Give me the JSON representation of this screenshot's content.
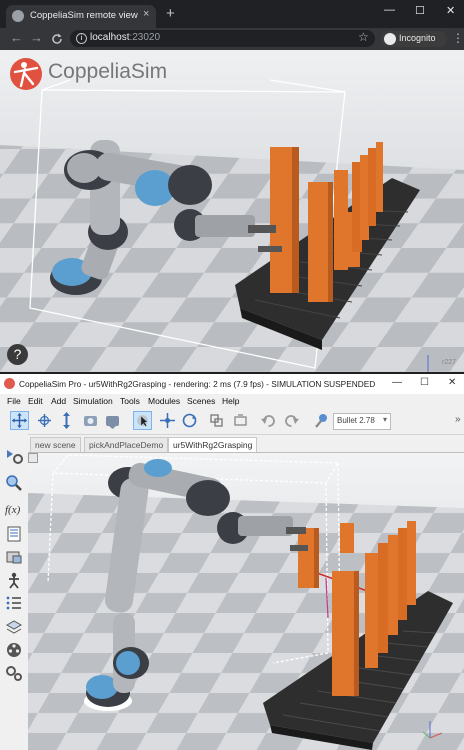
{
  "browser": {
    "tab_title": "CoppeliaSim remote view",
    "tab_close": "×",
    "new_tab": "+",
    "window_controls": [
      "—",
      "☐",
      "✕"
    ],
    "nav": {
      "back": "←",
      "forward": "→",
      "reload": "C"
    },
    "url_host": "localhost",
    "url_port": ":23020",
    "star": "☆",
    "incognito_label": "Incognito",
    "menu": "⋮"
  },
  "remote_view": {
    "logo_text": "CoppeliaSim",
    "help_label": "?",
    "revision": "r227"
  },
  "app": {
    "title": "CoppeliaSim Pro - ur5WithRg2Grasping - rendering: 2 ms (7.9 fps) - SIMULATION SUSPENDED",
    "window_controls": [
      "—",
      "☐",
      "✕"
    ],
    "menu": [
      "File",
      "Edit",
      "Add",
      "Simulation",
      "Tools",
      "Modules",
      "Scenes",
      "Help"
    ],
    "physics_engine": "Bullet 2.78",
    "more": "»",
    "scene_tabs": [
      {
        "label": "new scene",
        "active": false
      },
      {
        "label": "pickAndPlaceDemo",
        "active": false
      },
      {
        "label": "ur5WithRg2Grasping",
        "active": true
      }
    ]
  },
  "colors": {
    "conveyor": "#2e2e2e",
    "box": "#e0752c",
    "robot_joint": "#5a9fd0",
    "robot_body": "#a9adb2",
    "accent": "#e05a4f"
  }
}
